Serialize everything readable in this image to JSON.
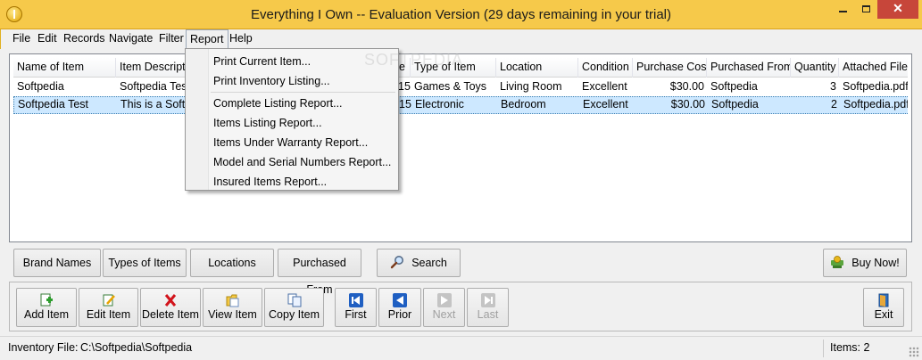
{
  "window": {
    "title": "Everything I Own -- Evaluation Version (29 days remaining in your trial)"
  },
  "menubar": [
    "File",
    "Edit",
    "Records",
    "Navigate",
    "Filter",
    "Report",
    "Help"
  ],
  "report_menu": {
    "items": [
      "Print Current Item...",
      "Print Inventory Listing...",
      "Complete Listing Report...",
      "Items Listing Report...",
      "Items Under Warranty Report...",
      "Model and Serial Numbers Report...",
      "Insured Items Report..."
    ]
  },
  "watermark": "SOFTPEDIA",
  "table": {
    "columns": [
      "Name of Item",
      "Item Descripti",
      "e",
      "Type of Item",
      "Location",
      "Condition",
      "Purchase Cost",
      "Purchased From",
      "Quantity",
      "Attached File"
    ],
    "rows": [
      [
        "Softpedia",
        "Softpedia Test",
        "15",
        "Games & Toys",
        "Living Room",
        "Excellent",
        "$30.00",
        "Softpedia",
        "3",
        "Softpedia.pdf"
      ],
      [
        "Softpedia Test",
        "This is a Softp",
        "15",
        "Electronic",
        "Bedroom",
        "Excellent",
        "$30.00",
        "Softpedia",
        "2",
        "Softpedia.pdf"
      ]
    ]
  },
  "filter_buttons": {
    "brand_names": "Brand Names",
    "types_of_items": "Types of Items",
    "locations": "Locations",
    "purchased_from": "Purchased From",
    "search": "Search",
    "buy_now": "Buy Now!"
  },
  "toolbar": {
    "add_item": "Add Item",
    "edit_item": "Edit Item",
    "delete_item": "Delete Item",
    "view_item": "View Item",
    "copy_item": "Copy Item",
    "first": "First",
    "prior": "Prior",
    "next": "Next",
    "last": "Last",
    "exit": "Exit"
  },
  "status": {
    "inventory_label": "Inventory File:",
    "inventory_path": "C:\\Softpedia\\Softpedia",
    "items_count": "Items: 2"
  },
  "colors": {
    "titlebar": "#f6c94a",
    "selection": "#cde8ff",
    "close_button": "#c7463a"
  }
}
